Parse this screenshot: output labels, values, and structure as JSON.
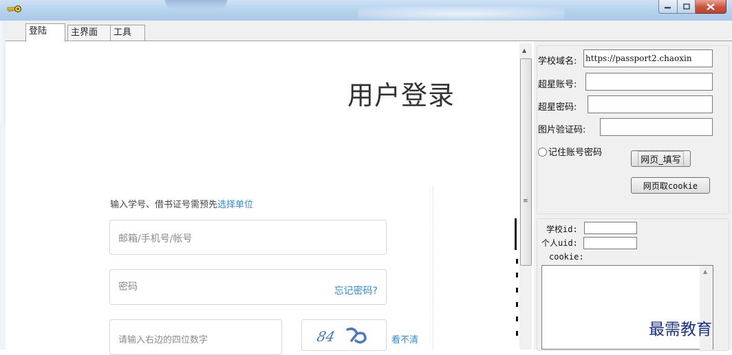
{
  "window": {
    "app_icon": "key-icon",
    "controls": [
      "minimize-icon",
      "maximize-icon",
      "close-icon"
    ]
  },
  "tabs": [
    {
      "label": "登陆",
      "active": true
    },
    {
      "label": "主界面",
      "active": false
    },
    {
      "label": "工具",
      "active": false
    }
  ],
  "web": {
    "title": "用户登录",
    "hint_prefix": "输入学号、借书证号需预先",
    "hint_link": "选择单位",
    "account_placeholder": "邮箱/手机号/帐号",
    "password_placeholder": "密码",
    "forgot_link": "忘记密码?",
    "captcha_placeholder": "请输入右边的四位数字",
    "captcha_text": "84",
    "refresh_link": "看不清"
  },
  "form": {
    "domain_label": "学校域名:",
    "domain_value": "https://passport2.chaoxin",
    "account_label": "超星账号:",
    "account_value": "",
    "password_label": "超星密码:",
    "password_value": "",
    "captcha_label": "图片验证码:",
    "captcha_value": "",
    "remember_label": "记住账号密码",
    "remember_checked": false,
    "fill_button": "网页_填写",
    "cookie_button": "网页取cookie"
  },
  "ids": {
    "school_id_label": "学校id:",
    "school_id_value": "",
    "uid_label": "个人uid:",
    "uid_value": "",
    "cookie_label": "cookie:",
    "cookie_value": ""
  },
  "watermark": "最需教育",
  "colors": {
    "link": "#2f8bd8",
    "titlebar": "#b8d4ee",
    "close_button": "#c9543a",
    "watermark": "#1a2f8a"
  }
}
